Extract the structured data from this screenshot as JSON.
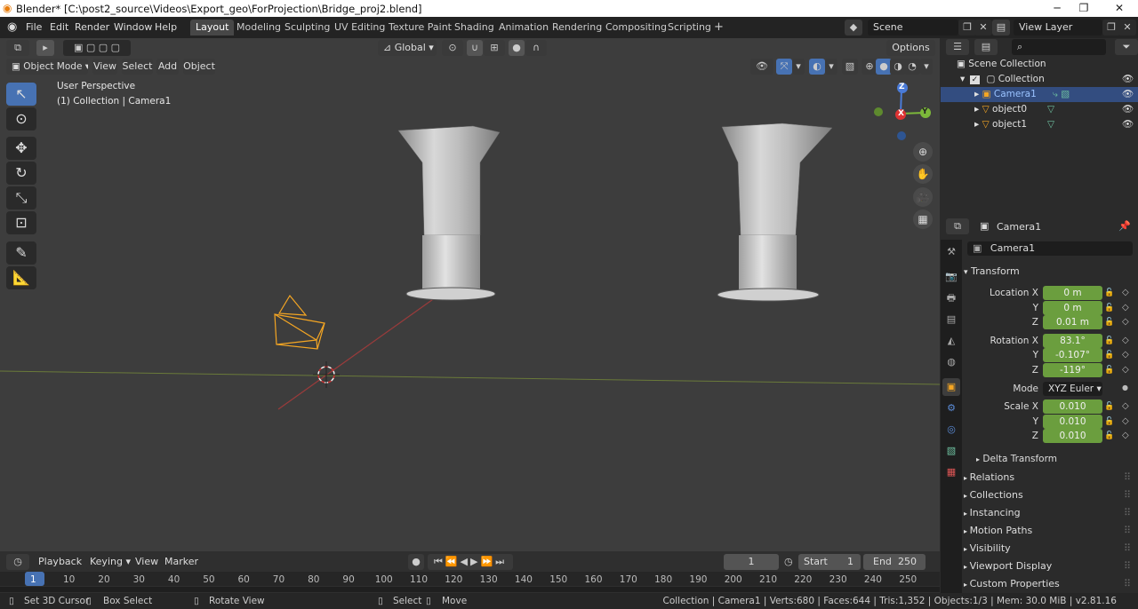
{
  "titlebar": {
    "title": "Blender* [C:\\post2_source\\Videos\\Export_geo\\ForProjection\\Bridge_proj2.blend]",
    "minimize": "─",
    "maximize": "❐",
    "close": "✕"
  },
  "menu": [
    "File",
    "Edit",
    "Render",
    "Window",
    "Help"
  ],
  "workspaces": [
    "Layout",
    "Modeling",
    "Sculpting",
    "UV Editing",
    "Texture Paint",
    "Shading",
    "Animation",
    "Rendering",
    "Compositing",
    "Scripting"
  ],
  "scene": {
    "name": "Scene"
  },
  "view_layer": {
    "name": "View Layer"
  },
  "viewport": {
    "mode": "Object Mode",
    "menu": [
      "View",
      "Select",
      "Add",
      "Object"
    ],
    "transform_orientation": "Global",
    "options": "Options",
    "info_line1": "User Perspective",
    "info_line2": "(1) Collection | Camera1",
    "gizmo": {
      "z": "Z",
      "x": "X",
      "y": "Y"
    }
  },
  "outliner": {
    "root": "Scene Collection",
    "collection": "Collection",
    "items": [
      "Camera1",
      "object0",
      "object1"
    ]
  },
  "properties": {
    "context_object": "Camera1",
    "object_name": "Camera1",
    "transform_header": "Transform",
    "location": {
      "label_x": "Location X",
      "x": "0 m",
      "y": "0 m",
      "z": "0.01 m"
    },
    "rotation": {
      "label_x": "Rotation X",
      "x": "83.1°",
      "y": "-0.107°",
      "z": "-119°"
    },
    "axis_labels": {
      "y": "Y",
      "z": "Z"
    },
    "mode_label": "Mode",
    "mode_value": "XYZ Euler",
    "scale": {
      "label_x": "Scale X",
      "x": "0.010",
      "y": "0.010",
      "z": "0.010"
    },
    "delta_transform": "Delta Transform",
    "panels": [
      "Relations",
      "Collections",
      "Instancing",
      "Motion Paths",
      "Visibility",
      "Viewport Display",
      "Custom Properties"
    ]
  },
  "timeline": {
    "playback": "Playback",
    "keying": "Keying",
    "view": "View",
    "marker": "Marker",
    "current_frame": "1",
    "start_label": "Start",
    "start": "1",
    "end_label": "End",
    "end": "250",
    "ticks": [
      "1",
      "10",
      "20",
      "30",
      "40",
      "50",
      "60",
      "70",
      "80",
      "90",
      "100",
      "110",
      "120",
      "130",
      "140",
      "150",
      "160",
      "170",
      "180",
      "190",
      "200",
      "210",
      "220",
      "230",
      "240",
      "250"
    ]
  },
  "statusbar": {
    "set_cursor": "Set 3D Cursor",
    "box_select": "Box Select",
    "rotate_view": "Rotate View",
    "select": "Select",
    "move": "Move",
    "stats": "Collection | Camera1 | Verts:680 | Faces:644 | Tris:1,352 | Objects:1/3 | Mem: 30.0 MiB | v2.81.16"
  },
  "colors": {
    "accent_blue": "#4772b3",
    "field_green": "#6b9e3e",
    "selected_orange": "#f5a623",
    "viewport_bg": "#3d3d3d"
  }
}
